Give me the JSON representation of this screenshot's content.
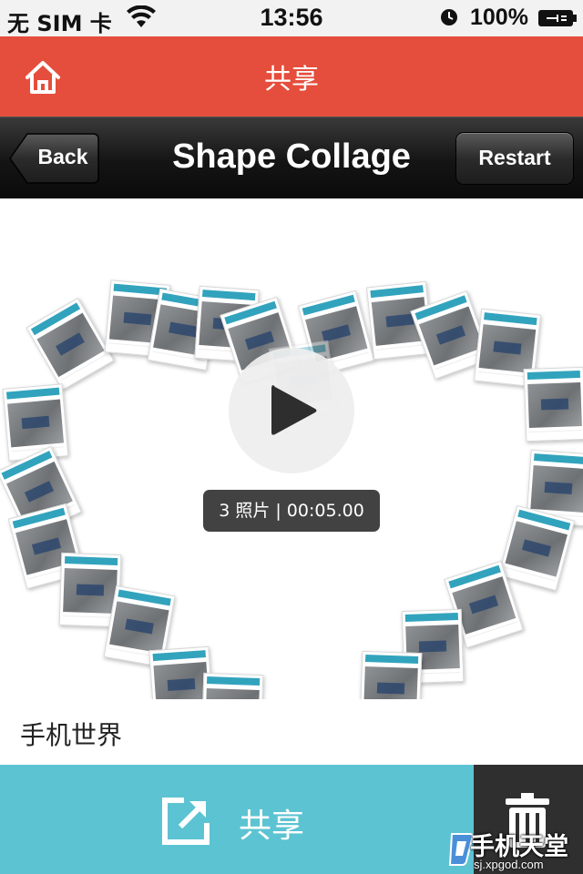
{
  "status_bar": {
    "carrier": "无 SIM 卡",
    "time": "13:56",
    "battery": "100%"
  },
  "header": {
    "title": "共享"
  },
  "nav": {
    "back_label": "Back",
    "title": "Shape Collage",
    "restart_label": "Restart"
  },
  "collage": {
    "info": "3 照片 | 00:05.00"
  },
  "caption": "手机世界",
  "bottom": {
    "share_label": "共享"
  },
  "watermark": {
    "brand": "手机天堂",
    "url": "sj.xpgod.com"
  },
  "colors": {
    "header_red": "#e54e3c",
    "share_teal": "#5cc3d2",
    "delete_dark": "#2f2f2f"
  }
}
